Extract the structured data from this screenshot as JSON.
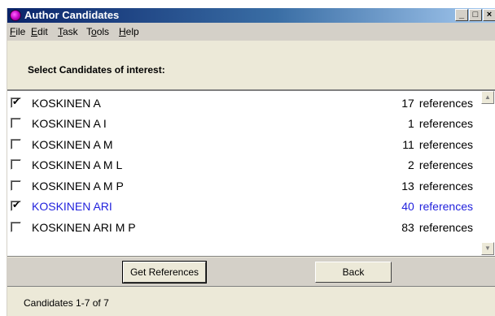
{
  "window": {
    "title": "Author Candidates",
    "controls": {
      "minimize": "_",
      "maximize": "□",
      "close": "×"
    }
  },
  "menu": [
    {
      "label": "File"
    },
    {
      "label": "Edit"
    },
    {
      "label": "Task"
    },
    {
      "label": "Tools"
    },
    {
      "label": "Help"
    }
  ],
  "prompt": "Select Candidates of interest:",
  "candidates": [
    {
      "name": "KOSKINEN A",
      "count": "17",
      "unit": "references",
      "checked": true,
      "highlighted": false
    },
    {
      "name": "KOSKINEN A I",
      "count": "1",
      "unit": "references",
      "checked": false,
      "highlighted": false
    },
    {
      "name": "KOSKINEN A M",
      "count": "11",
      "unit": "references",
      "checked": false,
      "highlighted": false
    },
    {
      "name": "KOSKINEN A M L",
      "count": "2",
      "unit": "references",
      "checked": false,
      "highlighted": false
    },
    {
      "name": "KOSKINEN A M P",
      "count": "13",
      "unit": "references",
      "checked": false,
      "highlighted": false
    },
    {
      "name": "KOSKINEN ARI",
      "count": "40",
      "unit": "references",
      "checked": true,
      "highlighted": true
    },
    {
      "name": "KOSKINEN ARI M P",
      "count": "83",
      "unit": "references",
      "checked": false,
      "highlighted": false
    }
  ],
  "buttons": {
    "get_references": "Get References",
    "back": "Back"
  },
  "status": "Candidates 1-7 of 7",
  "icons": {
    "app": "app-icon",
    "check": "✔",
    "scroll_up": "▲",
    "scroll_down": "▼"
  },
  "colors": {
    "highlight_text": "#2222dd",
    "titlebar": "#0a246a"
  }
}
